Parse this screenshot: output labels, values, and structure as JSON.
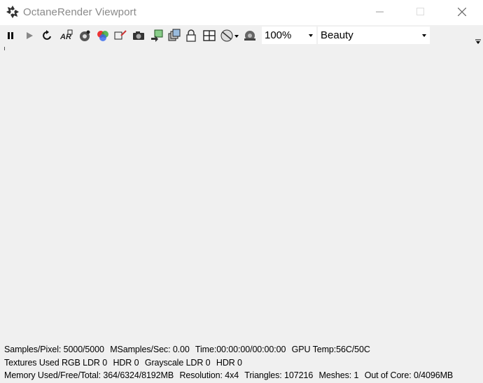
{
  "window": {
    "title": "OctaneRender Viewport"
  },
  "toolbar": {
    "buttons": [
      {
        "name": "pause-icon"
      },
      {
        "name": "play-icon"
      },
      {
        "name": "restart-icon"
      },
      {
        "name": "region-render-icon"
      },
      {
        "name": "pick-focus-icon"
      },
      {
        "name": "pick-white-balance-icon"
      },
      {
        "name": "pick-material-icon"
      },
      {
        "name": "camera-icon"
      },
      {
        "name": "export-icon"
      },
      {
        "name": "layers-icon"
      },
      {
        "name": "lock-icon"
      },
      {
        "name": "grid-layout-icon"
      },
      {
        "name": "settings-disc-icon"
      },
      {
        "name": "camera-view-icon"
      }
    ],
    "zoom": {
      "value": "100%"
    },
    "render_pass": {
      "value": "Beauty"
    }
  },
  "status": {
    "line1": {
      "samples": "Samples/Pixel: 5000/5000",
      "msamples": "MSamples/Sec: 0.00",
      "time": "Time:00:00:00/00:00:00",
      "gpu_temp": "GPU Temp:56C/50C"
    },
    "line2": {
      "textures_rgb": "Textures Used RGB LDR 0",
      "textures_hdr": "HDR 0",
      "grayscale": "Grayscale LDR 0",
      "grayscale_hdr": "HDR 0"
    },
    "line3": {
      "memory": "Memory Used/Free/Total: 364/6324/8192MB",
      "resolution": "Resolution: 4x4",
      "triangles": "Triangles: 107216",
      "meshes": "Meshes: 1",
      "out_of_core": "Out of Core: 0/4096MB"
    }
  },
  "colors": {
    "background": "#f0f0f0",
    "titlebar": "#ffffff",
    "title_text": "#8a8a8a"
  }
}
